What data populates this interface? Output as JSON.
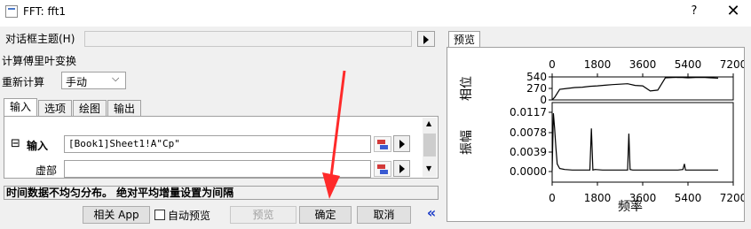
{
  "window": {
    "title": "FFT: fft1",
    "help": "?",
    "close": "✕"
  },
  "dialog_theme": {
    "label": "对话框主题(H)",
    "value": ""
  },
  "section_title": "计算傅里叶变换",
  "recalc": {
    "label": "重新计算",
    "value": "手动"
  },
  "tabs": [
    {
      "label": "输入",
      "active": true
    },
    {
      "label": "选项",
      "active": false
    },
    {
      "label": "绘图",
      "active": false
    },
    {
      "label": "输出",
      "active": false
    }
  ],
  "input_panel": {
    "group_toggle": "⊟",
    "input_label": "输入",
    "input_value": "[Book1]Sheet1!A\"Cp\"",
    "imag_label": "虚部",
    "imag_value": ""
  },
  "status_message": "时间数据不均匀分布。 绝对平均增量设置为间隔",
  "buttons": {
    "related_app": "相关 App",
    "auto_preview": "自动预览",
    "auto_preview_checked": false,
    "preview": "预览",
    "ok": "确定",
    "cancel": "取消",
    "collapse": "«"
  },
  "preview_tab": "预览",
  "chart_data": [
    {
      "type": "line",
      "ylabel": "相位",
      "x_ticks": [
        "0",
        "1800",
        "3600",
        "5400",
        "7200"
      ],
      "y_ticks": [
        "540",
        "270",
        "0"
      ],
      "xlim": [
        0,
        7200
      ],
      "ylim": [
        0,
        540
      ],
      "x": [
        0,
        100,
        300,
        600,
        900,
        1200,
        1500,
        1800,
        2100,
        2400,
        2700,
        3000,
        3300,
        3600,
        3900,
        4200,
        4500,
        4800,
        5100,
        5400,
        5700,
        6000,
        6300,
        6600
      ],
      "values": [
        0,
        60,
        250,
        270,
        290,
        300,
        320,
        330,
        345,
        360,
        370,
        380,
        340,
        330,
        210,
        230,
        520,
        525,
        530,
        520,
        525,
        530,
        520,
        510
      ]
    },
    {
      "type": "line",
      "xlabel": "频率",
      "ylabel": "振幅",
      "x_ticks": [
        "0",
        "1800",
        "3600",
        "5400",
        "7200"
      ],
      "y_ticks": [
        "0.0117",
        "0.0078",
        "0.0039",
        "0.0000"
      ],
      "xlim": [
        0,
        7200
      ],
      "ylim": [
        0,
        0.0117
      ],
      "x": [
        0,
        50,
        100,
        150,
        200,
        300,
        500,
        800,
        1200,
        1500,
        1560,
        1620,
        1700,
        2000,
        2500,
        3000,
        3050,
        3100,
        3200,
        3600,
        4000,
        4500,
        5000,
        5200,
        5260,
        5300,
        5800,
        6300,
        6600
      ],
      "values": [
        0.0002,
        0.0115,
        0.0085,
        0.0045,
        0.0015,
        0.0006,
        0.0004,
        0.0003,
        0.0003,
        0.0003,
        0.0085,
        0.0003,
        0.0004,
        0.0003,
        0.0003,
        0.0003,
        0.0075,
        0.0004,
        0.0003,
        0.0003,
        0.0003,
        0.0003,
        0.0003,
        0.0004,
        0.0015,
        0.0003,
        0.0003,
        0.0003,
        0.0003
      ]
    }
  ],
  "annotation_arrow_color": "#ff2a2a"
}
